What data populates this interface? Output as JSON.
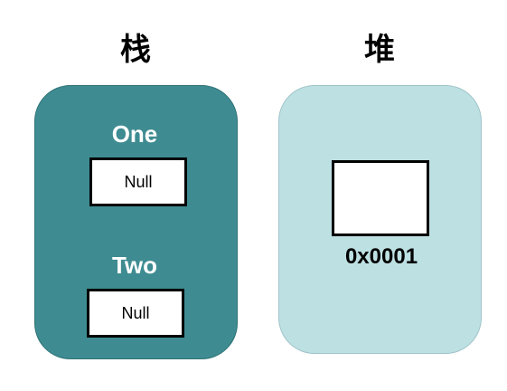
{
  "stack": {
    "title": "栈",
    "variables": [
      {
        "name": "One",
        "value": "Null"
      },
      {
        "name": "Two",
        "value": "Null"
      }
    ],
    "color": "#3e8c91"
  },
  "heap": {
    "title": "堆",
    "object": {
      "address": "0x0001"
    },
    "color": "#bde0e3"
  }
}
